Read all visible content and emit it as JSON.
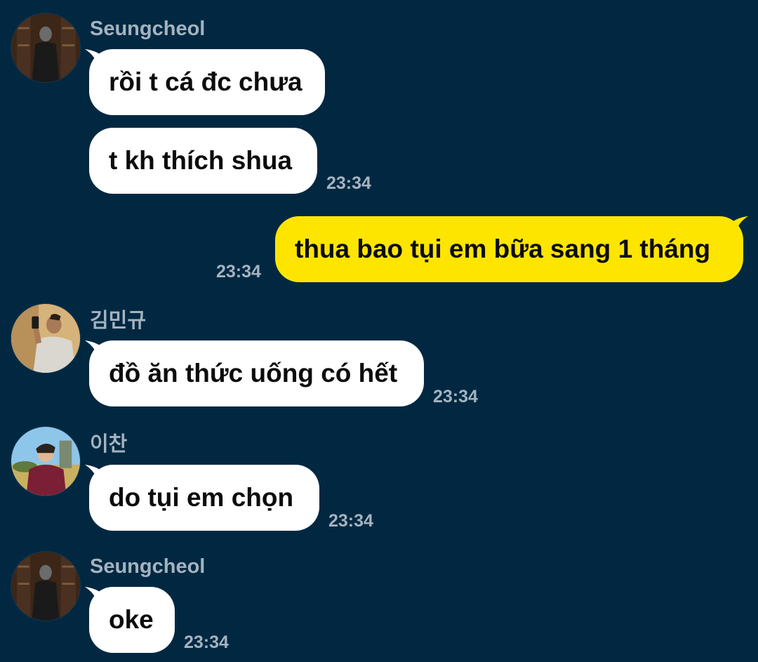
{
  "chat": {
    "colors": {
      "background": "#022841",
      "incoming_bubble": "#ffffff",
      "outgoing_bubble": "#fee500",
      "meta_text": "#a4b3c0"
    },
    "groups": [
      {
        "sender": "Seungcheol",
        "avatar_icon": "profile-photo-dark",
        "messages": [
          {
            "text": "rồi t cá đc chưa",
            "time": ""
          },
          {
            "text": "t kh thích shua",
            "time": "23:34"
          }
        ]
      },
      {
        "sender": "me",
        "messages": [
          {
            "text": "thua bao tụi em bữa sang 1 tháng",
            "time": "23:34"
          }
        ]
      },
      {
        "sender": "김민규",
        "avatar_icon": "profile-photo-mirror-selfie",
        "messages": [
          {
            "text": "đồ ăn thức uống có hết",
            "time": "23:34"
          }
        ]
      },
      {
        "sender": "이찬",
        "avatar_icon": "profile-photo-outdoor",
        "messages": [
          {
            "text": "do tụi em chọn",
            "time": "23:34"
          }
        ]
      },
      {
        "sender": "Seungcheol",
        "avatar_icon": "profile-photo-dark",
        "messages": [
          {
            "text": "oke",
            "time": "23:34"
          }
        ]
      }
    ]
  }
}
